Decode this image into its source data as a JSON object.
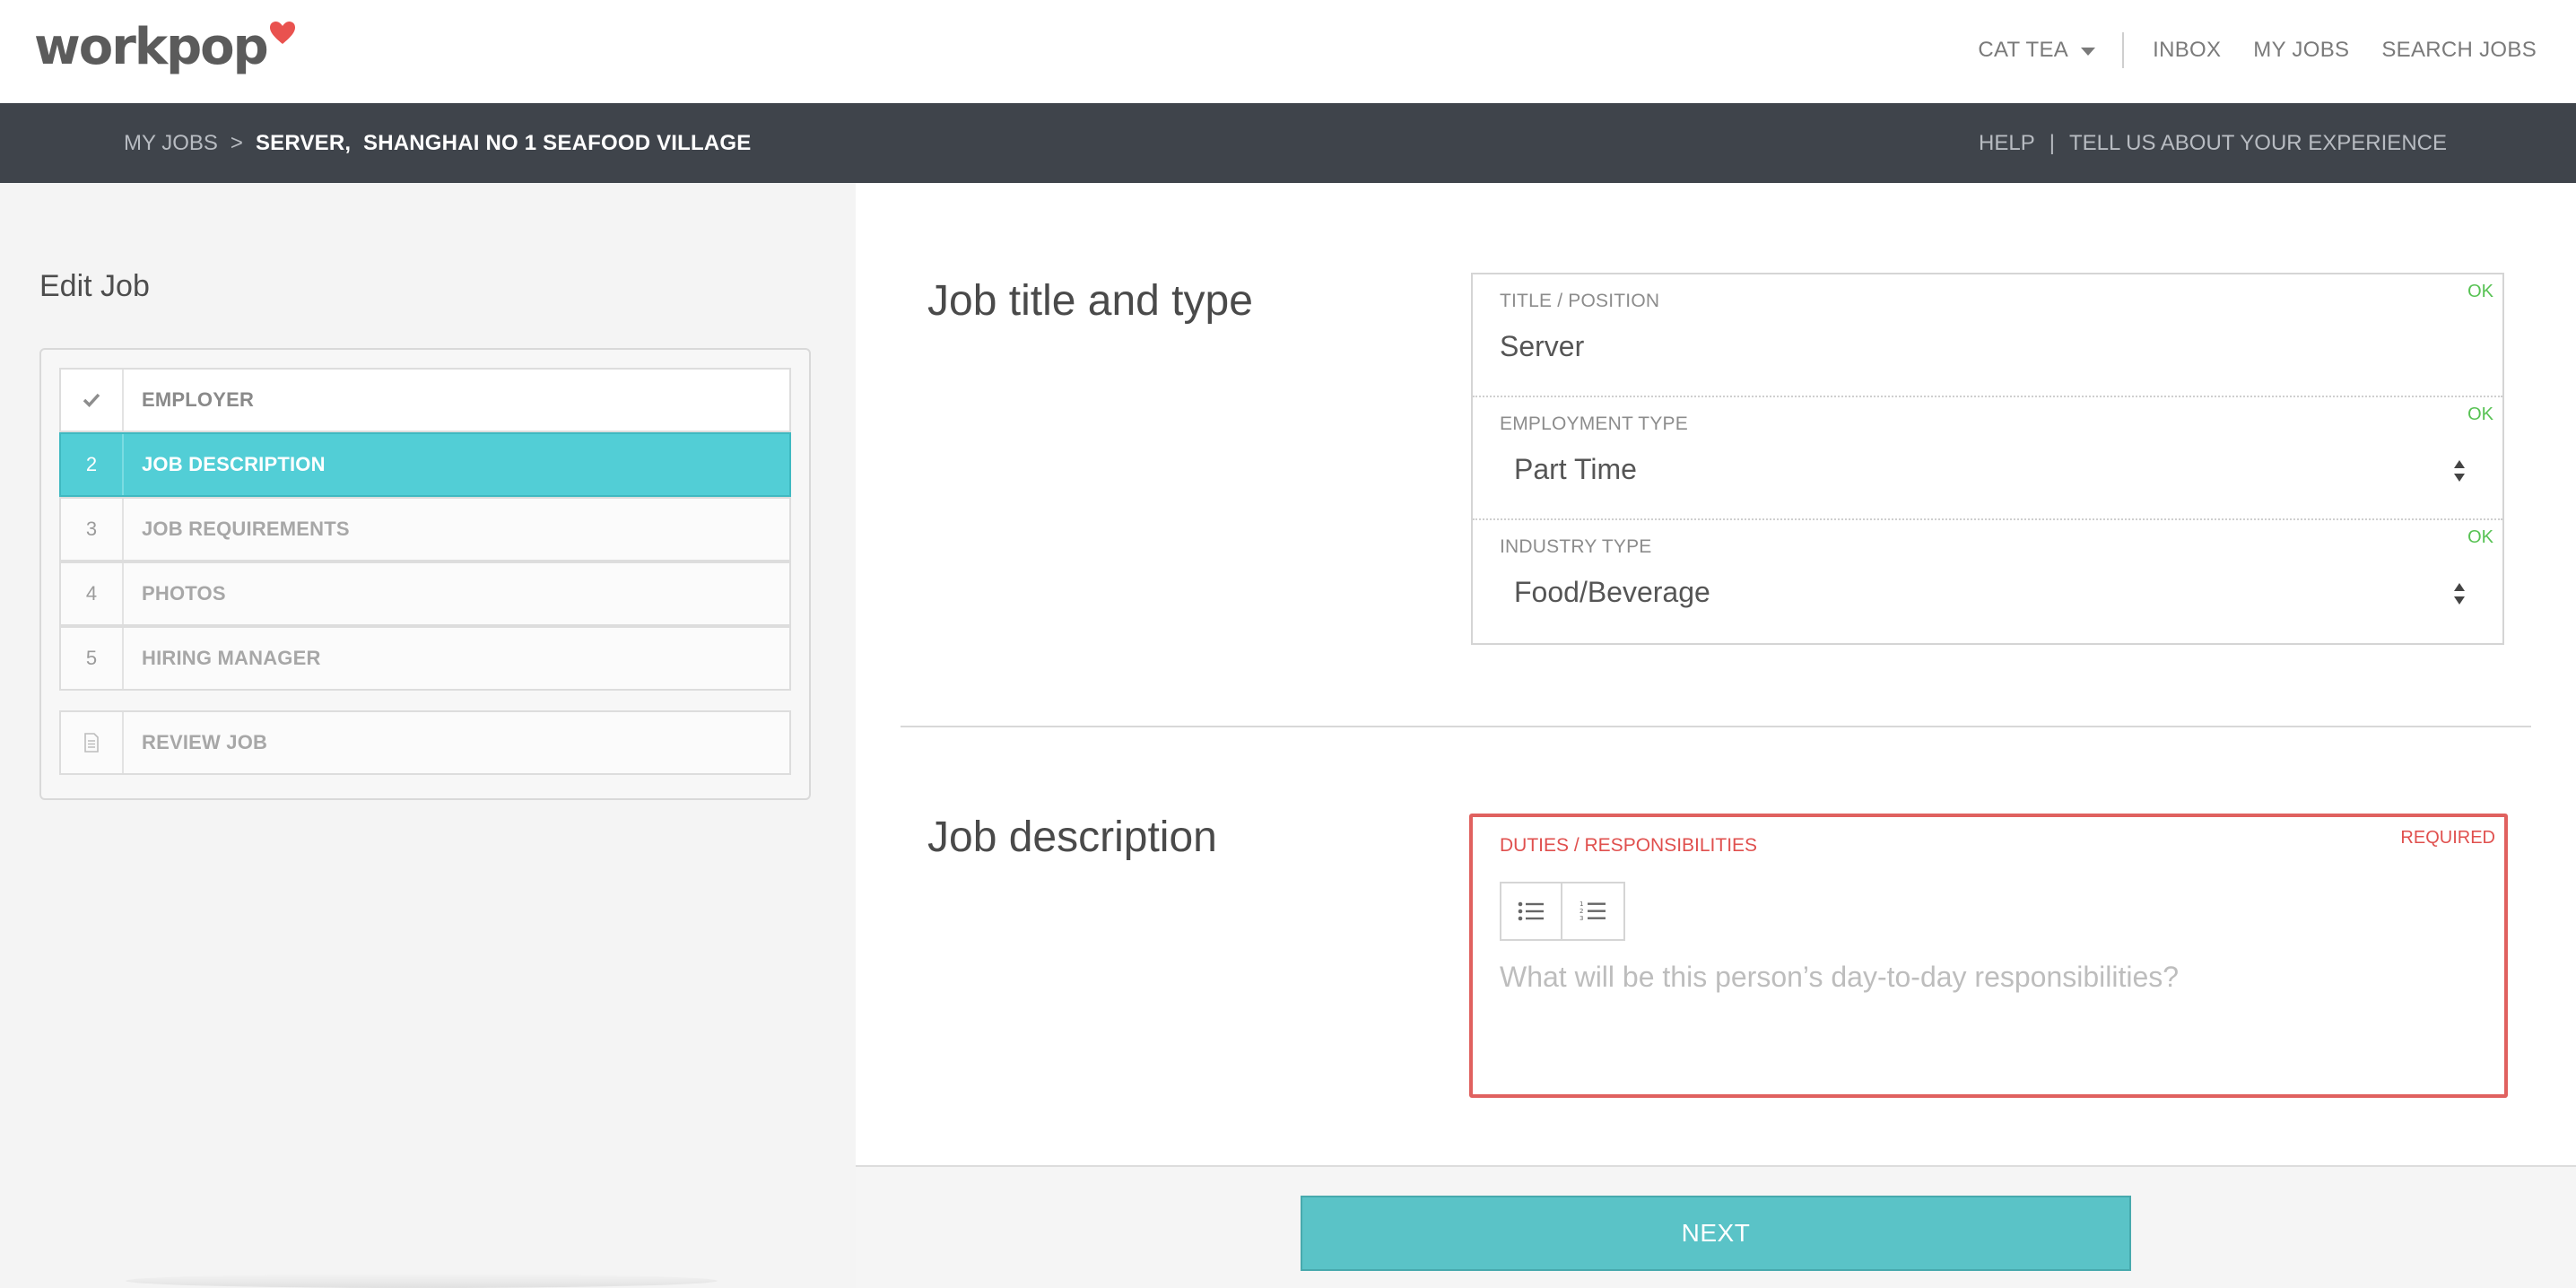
{
  "header": {
    "logo_text": "workpop",
    "user_name": "CAT TEA",
    "nav": [
      "INBOX",
      "MY JOBS",
      "SEARCH JOBS"
    ]
  },
  "subbar": {
    "breadcrumb_root": "MY JOBS",
    "breadcrumb_sep": ">",
    "breadcrumb_current": "SERVER,  SHANGHAI NO 1 SEAFOOD VILLAGE",
    "help": "HELP",
    "pipe": "|",
    "feedback": "TELL US ABOUT YOUR EXPERIENCE"
  },
  "sidebar": {
    "title": "Edit Job",
    "steps": [
      {
        "num": "",
        "label": "EMPLOYER",
        "state": "done"
      },
      {
        "num": "2",
        "label": "JOB DESCRIPTION",
        "state": "active"
      },
      {
        "num": "3",
        "label": "JOB REQUIREMENTS",
        "state": "pending"
      },
      {
        "num": "4",
        "label": "PHOTOS",
        "state": "pending"
      },
      {
        "num": "5",
        "label": "HIRING MANAGER",
        "state": "pending"
      }
    ],
    "review": {
      "label": "REVIEW JOB"
    }
  },
  "job_title_section": {
    "title": "Job title and type",
    "fields": {
      "title": {
        "label": "TITLE / POSITION",
        "value": "Server",
        "status": "OK"
      },
      "employment": {
        "label": "EMPLOYMENT TYPE",
        "value": "Part Time",
        "status": "OK"
      },
      "industry": {
        "label": "INDUSTRY TYPE",
        "value": "Food/Beverage",
        "status": "OK"
      }
    }
  },
  "job_description_section": {
    "title": "Job description",
    "label": "DUTIES / RESPONSIBILITIES",
    "status": "REQUIRED",
    "placeholder": "What will be this person’s day-to-day responsibilities?"
  },
  "footer": {
    "next_label": "NEXT"
  },
  "colors": {
    "accent": "#52ced6",
    "ok": "#57c253",
    "required": "#e0615f",
    "subbar": "#3f444b",
    "next_button": "#5ac3c7"
  }
}
